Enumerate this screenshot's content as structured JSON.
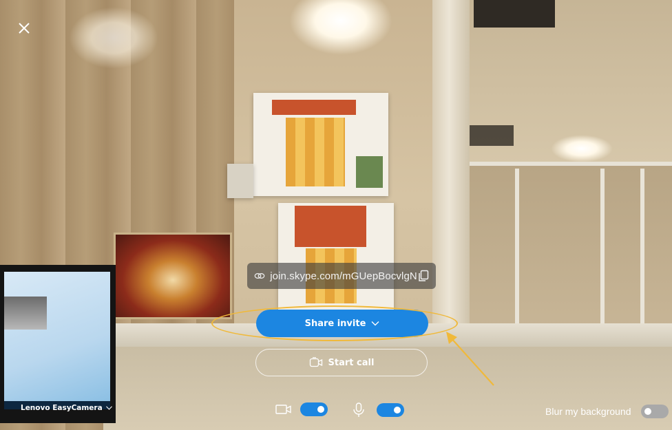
{
  "window": {
    "close_icon": "close-icon"
  },
  "invite": {
    "link_icon": "link-icon",
    "link_text": "join.skype.com/mGUepBocvlgN",
    "copy_icon": "copy-icon"
  },
  "actions": {
    "share_label": "Share invite",
    "share_chevron_icon": "chevron-down-icon",
    "start_call_label": "Start call",
    "start_call_icon": "video-camera-icon"
  },
  "devices": {
    "camera_name": "Lenovo EasyCamera",
    "camera_chevron_icon": "chevron-down-icon",
    "video_icon": "video-icon",
    "video_enabled": true,
    "mic_icon": "microphone-icon",
    "mic_enabled": true
  },
  "background": {
    "blur_label": "Blur my background",
    "blur_enabled": false
  },
  "colors": {
    "accent": "#1c86e1",
    "annotation": "#f0b93a"
  }
}
